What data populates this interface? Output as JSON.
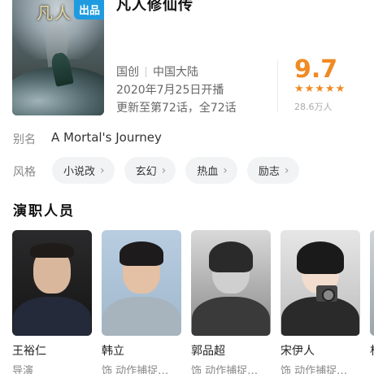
{
  "poster": {
    "badge": "出品",
    "logo": "凡人"
  },
  "title": "凡人修仙传",
  "meta": {
    "category": "国创",
    "region": "中国大陆",
    "premiere": "2020年7月25日开播",
    "update": "更新至第72话，全72话"
  },
  "rating": {
    "score": "9.7",
    "stars": 5,
    "raters": "28.6万人",
    "accent_color": "#f08a24"
  },
  "alias": {
    "label": "别名",
    "value": "A Mortal's Journey"
  },
  "style": {
    "label": "风格",
    "tags": [
      {
        "label": "小说改"
      },
      {
        "label": "玄幻"
      },
      {
        "label": "热血"
      },
      {
        "label": "励志"
      }
    ]
  },
  "cast_section": {
    "title": "演职人员"
  },
  "cast": [
    {
      "name": "王裕仁",
      "role": "导演"
    },
    {
      "name": "韩立",
      "role": "饰  动作捕捉…"
    },
    {
      "name": "郭品超",
      "role": "饰  动作捕捉…"
    },
    {
      "name": "宋伊人",
      "role": "饰  动作捕捉…"
    },
    {
      "name": "杜"
    }
  ]
}
